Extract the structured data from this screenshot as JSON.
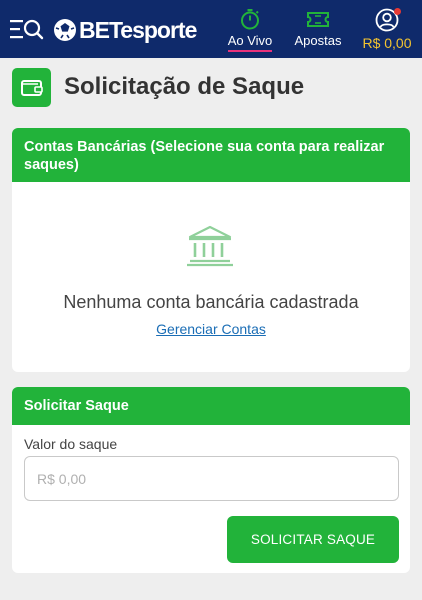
{
  "header": {
    "brand": "BETesporte",
    "menu_icon": "menu-search-icon",
    "nav": [
      {
        "label": "Ao Vivo",
        "icon": "stopwatch-icon",
        "active": true
      },
      {
        "label": "Apostas",
        "icon": "ticket-icon",
        "active": false
      }
    ],
    "account": {
      "balance": "R$ 0,00",
      "icon": "user-icon",
      "has_notification": true
    }
  },
  "page": {
    "title": "Solicitação de Saque",
    "title_icon": "wallet-icon"
  },
  "accounts_card": {
    "header": "Contas Bancárias (Selecione sua conta para realizar saques)",
    "empty_icon": "bank-icon",
    "empty_text": "Nenhuma conta bancária cadastrada",
    "manage_link": "Gerenciar Contas"
  },
  "withdraw_card": {
    "header": "Solicitar Saque",
    "amount_label": "Valor do saque",
    "amount_value": "",
    "amount_placeholder": "R$ 0,00",
    "submit_label": "SOLICITAR SAQUE"
  },
  "colors": {
    "header_bg": "#0f2a6b",
    "accent_green": "#22b33a",
    "active_underline": "#e8327b",
    "balance": "#f4c430",
    "link": "#1a6db5"
  }
}
